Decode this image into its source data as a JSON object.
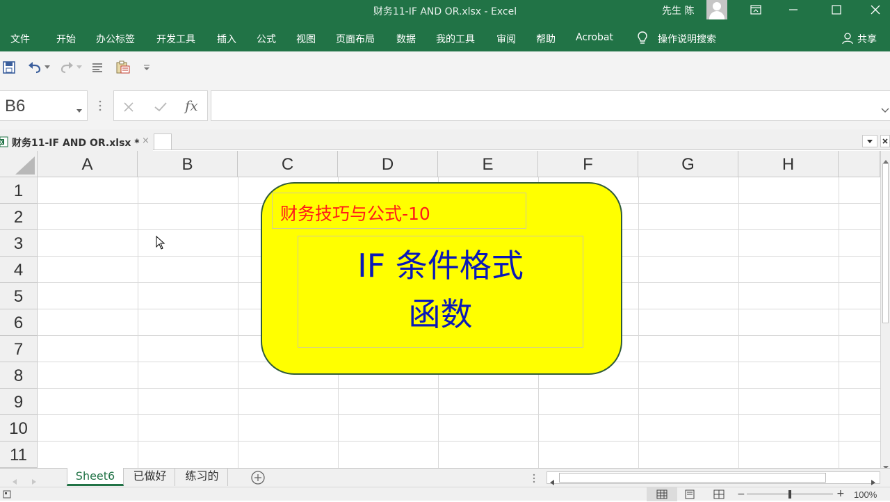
{
  "window": {
    "title": "财务11-IF AND OR.xlsx  -  Excel",
    "user": "先生 陈"
  },
  "ribbon": {
    "tabs": [
      "文件",
      "开始",
      "办公标签",
      "开发工具",
      "插入",
      "公式",
      "视图",
      "页面布局",
      "数据",
      "我的工具",
      "审阅",
      "帮助",
      "Acrobat"
    ],
    "search": "操作说明搜索",
    "share": "共享"
  },
  "formula_bar": {
    "name_box": "B6",
    "fx": "fx",
    "formula": ""
  },
  "workbook_tab": {
    "label": "财务11-IF AND OR.xlsx *",
    "close": "×"
  },
  "grid": {
    "columns": [
      "A",
      "B",
      "C",
      "D",
      "E",
      "F",
      "G",
      "H"
    ],
    "rows": [
      "1",
      "2",
      "3",
      "4",
      "5",
      "6",
      "7",
      "8",
      "9",
      "10",
      "11"
    ]
  },
  "shape": {
    "subtitle": "财务技巧与公式-10",
    "main_line1": "IF 条件格式",
    "main_line2": "函数",
    "fill_color": "#ffff00",
    "subtitle_color": "#ff1a1a",
    "main_color": "#0a18b8"
  },
  "sheets": {
    "tabs": [
      "Sheet6",
      "已做好",
      "练习的"
    ],
    "active": "Sheet6"
  },
  "status": {
    "zoom": "100%"
  },
  "colors": {
    "excel_green": "#217346"
  }
}
